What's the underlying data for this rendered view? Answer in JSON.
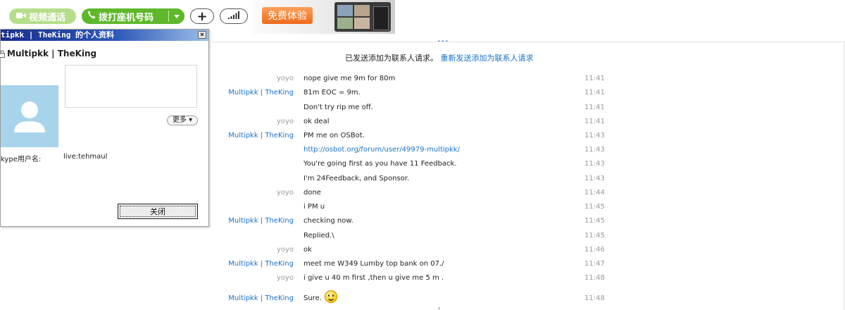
{
  "toolbar": {
    "video_call_label": "视频通话",
    "landline_call_label": "拨打座机号码",
    "add_label": "+"
  },
  "ad": {
    "button_label": "免费体验"
  },
  "more_indicator": "...",
  "status": {
    "text": "已发送添加为联系人请求。",
    "resend_link": "重新发送添加为联系人请求"
  },
  "messages": [
    {
      "sender": "yoyo",
      "role": "me",
      "text": "nope give me 9m for 80m",
      "time": "11:41"
    },
    {
      "sender": "Multipkk | TheKing",
      "role": "them",
      "text": "81m EOC = 9m.",
      "time": "11:41"
    },
    {
      "sender": "",
      "role": "them",
      "text": "Don't try rip me off.",
      "time": "11:41"
    },
    {
      "sender": "yoyo",
      "role": "me",
      "text": "ok  deal",
      "time": "11:41"
    },
    {
      "sender": "Multipkk | TheKing",
      "role": "them",
      "text": "PM me on OSBot.",
      "time": "11:43"
    },
    {
      "sender": "",
      "role": "them",
      "text": "http://osbot.org/forum/user/49979-multipkk/",
      "time": "11:43",
      "is_link": true
    },
    {
      "sender": "",
      "role": "them",
      "text": "You're going first as you have 11 Feedback.",
      "time": "11:43"
    },
    {
      "sender": "",
      "role": "them",
      "text": "I'm 24Feedback, and Sponsor.",
      "time": "11:43"
    },
    {
      "sender": "yoyo",
      "role": "me",
      "text": "done",
      "time": "11:44"
    },
    {
      "sender": "",
      "role": "me",
      "text": "i PM u",
      "time": "11:45"
    },
    {
      "sender": "Multipkk | TheKing",
      "role": "them",
      "text": "checking now.",
      "time": "11:45"
    },
    {
      "sender": "",
      "role": "them",
      "text": "Replied.\\",
      "time": "11:45"
    },
    {
      "sender": "yoyo",
      "role": "me",
      "text": "ok",
      "time": "11:46"
    },
    {
      "sender": "Multipkk | TheKing",
      "role": "them",
      "text": "meet me W349 Lumby top bank on 07./",
      "time": "11:47"
    },
    {
      "sender": "yoyo",
      "role": "me",
      "text": "i give u 40 m first ,then u give me 5 m .",
      "time": "11:48"
    },
    {
      "sender": "Multipkk | TheKing",
      "role": "them",
      "text": "Sure.",
      "time": "11:48",
      "emoji": "smile-emoji"
    }
  ],
  "profile_dialog": {
    "title": "tipkk | TheKing 的个人资料",
    "close_glyph": "×",
    "display_name": "Multipkk | TheKing",
    "more_button": "更多",
    "skype_label": "kype用户名:",
    "skype_value": "live:tehmaul",
    "close_button": "关闭"
  },
  "colors": {
    "call_green": "#5fb82a",
    "video_green": "#b6de8a",
    "link_blue": "#1a73c8",
    "title_bar": "#1a2f8c",
    "ad_orange": "#ee6a18",
    "avatar_blue": "#a7d4ea"
  }
}
